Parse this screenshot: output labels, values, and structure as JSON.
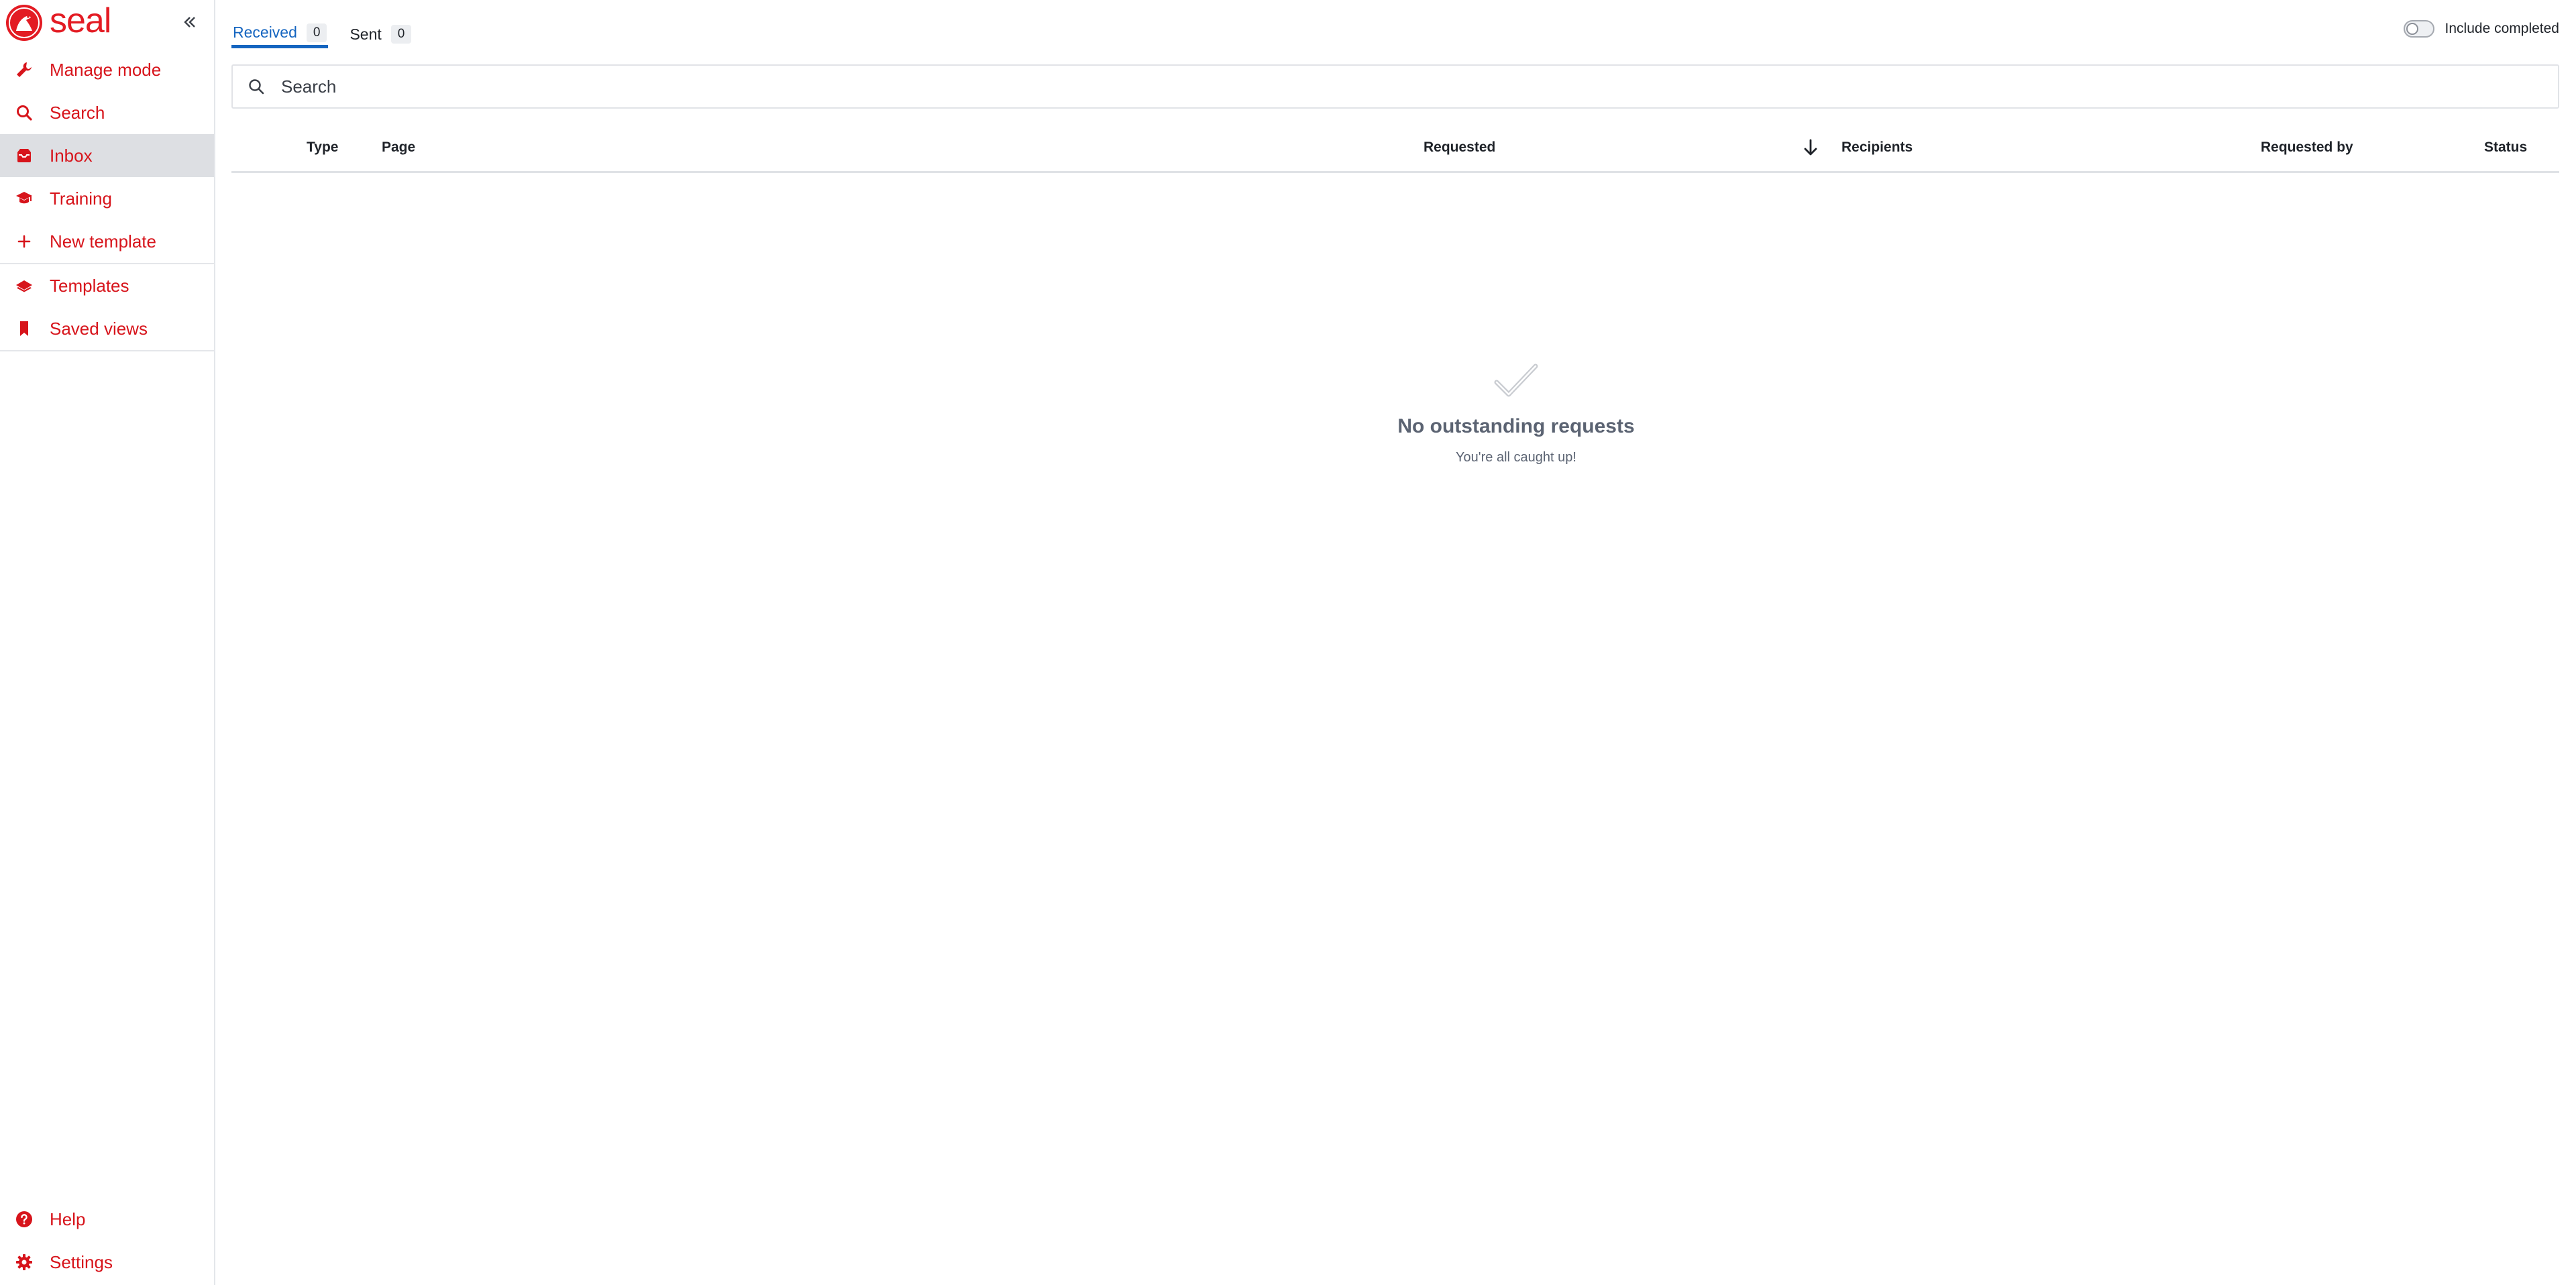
{
  "brand": {
    "name": "seal",
    "color": "#e31b23"
  },
  "sidebar": {
    "collapse_icon": "double-chevron-left-icon",
    "items": [
      {
        "label": "Manage mode",
        "icon": "wrench-icon"
      },
      {
        "label": "Search",
        "icon": "search-icon"
      },
      {
        "label": "Inbox",
        "icon": "inbox-icon",
        "active": true
      },
      {
        "label": "Training",
        "icon": "graduation-cap-icon"
      },
      {
        "label": "New template",
        "icon": "plus-icon"
      },
      {
        "label": "Templates",
        "icon": "layers-icon"
      },
      {
        "label": "Saved views",
        "icon": "bookmark-icon"
      }
    ],
    "bottom_items": [
      {
        "label": "Help",
        "icon": "help-circle-icon"
      },
      {
        "label": "Settings",
        "icon": "gear-icon"
      }
    ]
  },
  "tabs": [
    {
      "label": "Received",
      "count": "0",
      "active": true
    },
    {
      "label": "Sent",
      "count": "0",
      "active": false
    }
  ],
  "filters": {
    "include_completed_label": "Include completed",
    "include_completed": false
  },
  "search": {
    "placeholder": "Search",
    "value": ""
  },
  "table": {
    "columns": [
      "Type",
      "Page",
      "Requested",
      "Recipients",
      "Requested by",
      "Status"
    ],
    "sort_icon": "arrow-down-icon",
    "rows": []
  },
  "empty_state": {
    "icon": "checkmark-icon",
    "title": "No outstanding requests",
    "subtitle": "You're all caught up!"
  },
  "colors": {
    "accent_red": "#d7141b",
    "active_tab_blue": "#1565c0"
  }
}
